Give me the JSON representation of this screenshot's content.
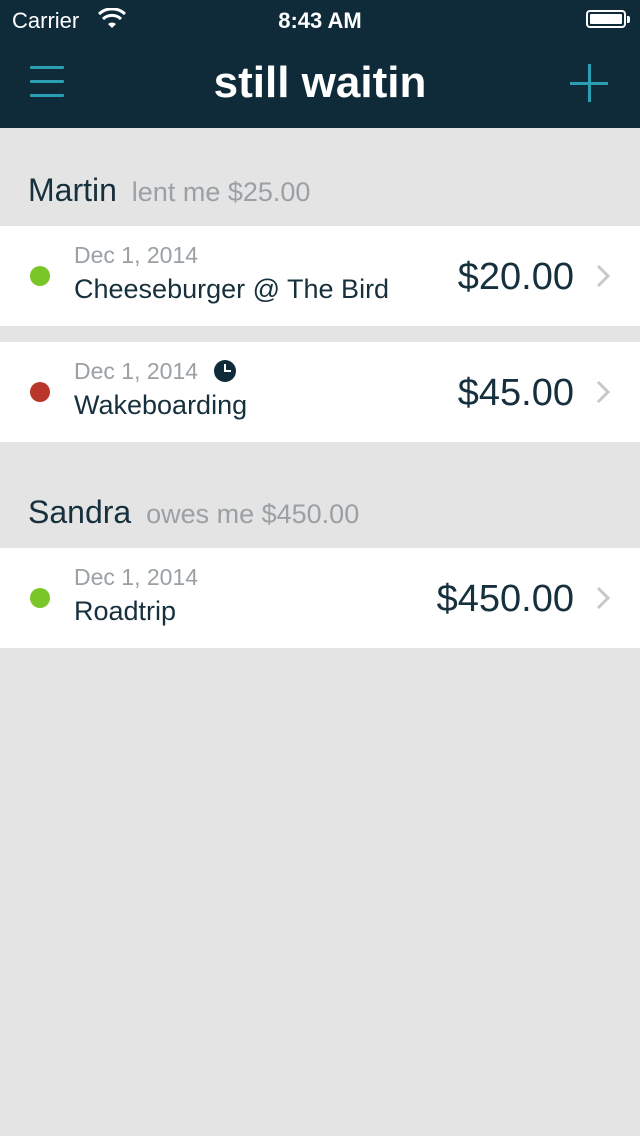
{
  "status_bar": {
    "carrier": "Carrier",
    "time": "8:43 AM"
  },
  "nav": {
    "title": "still waitin",
    "menu_icon": "hamburger-menu-icon",
    "add_icon": "plus-icon"
  },
  "colors": {
    "nav_background": "#0f2a38",
    "accent": "#2a9fb3",
    "status_paid": "#7ac628",
    "status_overdue": "#b8372a",
    "background": "#e4e4e4"
  },
  "groups": [
    {
      "name": "Martin",
      "summary": "lent me $25.00",
      "items": [
        {
          "date": "Dec 1, 2014",
          "title": "Cheeseburger @ The Bird",
          "amount": "$20.00",
          "status": "green",
          "has_clock": false
        },
        {
          "date": "Dec 1, 2014",
          "title": "Wakeboarding",
          "amount": "$45.00",
          "status": "red",
          "has_clock": true
        }
      ]
    },
    {
      "name": "Sandra",
      "summary": "owes me $450.00",
      "items": [
        {
          "date": "Dec 1, 2014",
          "title": "Roadtrip",
          "amount": "$450.00",
          "status": "green",
          "has_clock": false
        }
      ]
    }
  ]
}
